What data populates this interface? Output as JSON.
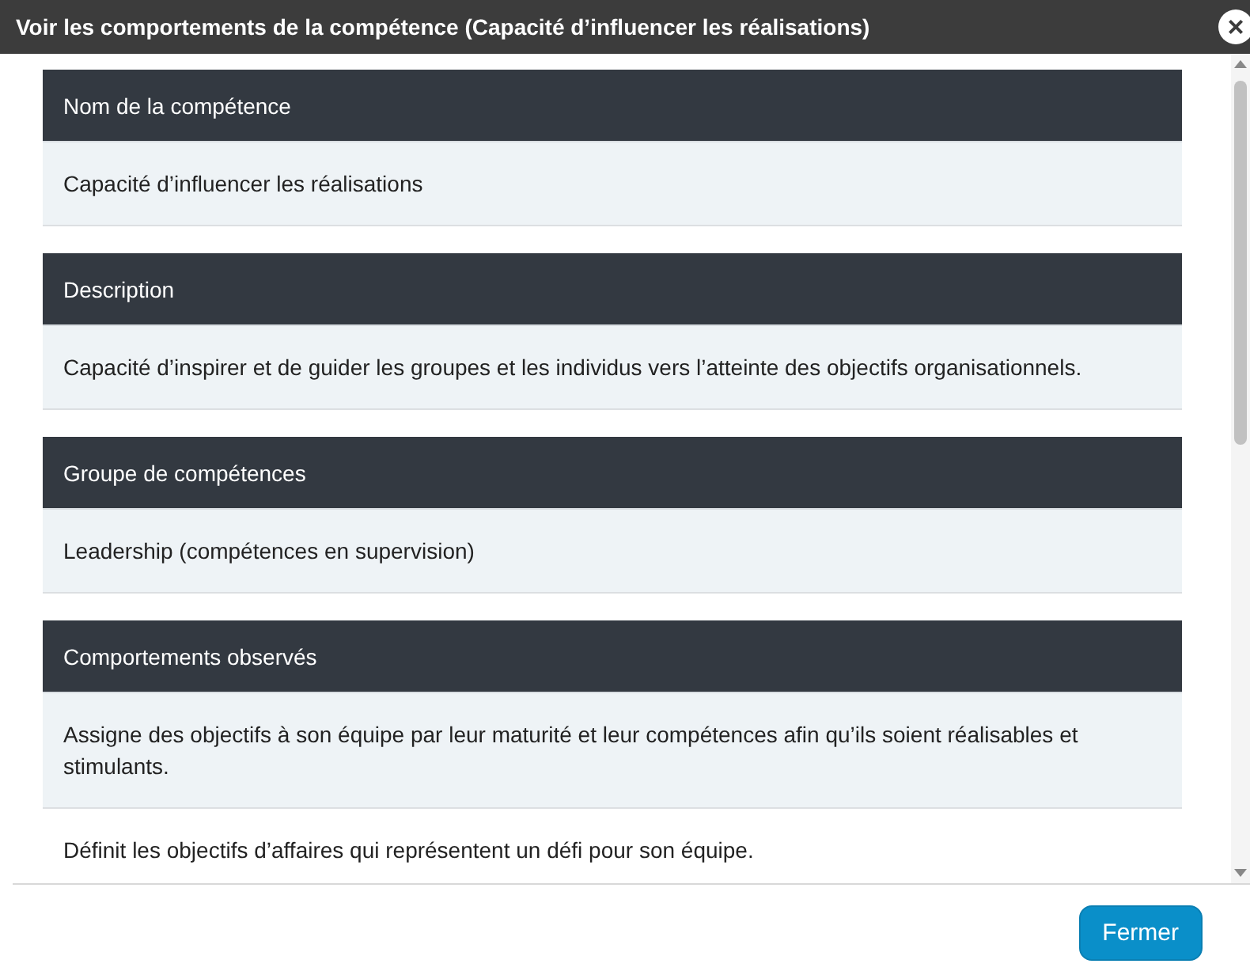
{
  "window": {
    "title": "Voir les comportements de la compétence (Capacité d’influencer les réalisations)",
    "close": "×"
  },
  "sections": [
    {
      "heading": "Nom de la compétence",
      "rows": [
        "Capacité d’influencer les réalisations"
      ]
    },
    {
      "heading": "Description",
      "rows": [
        "Capacité d’inspirer et de guider les groupes et les individus vers l’atteinte des objectifs organisationnels."
      ]
    },
    {
      "heading": "Groupe de compétences",
      "rows": [
        "Leadership (compétences en supervision)"
      ]
    },
    {
      "heading": "Comportements observés",
      "rows": [
        "Assigne des objectifs à son équipe par leur maturité et leur compétences afin qu’ils soient réalisables et stimulants.",
        "Définit les objectifs d’affaires qui représentent un défi pour son équipe."
      ]
    }
  ],
  "buttons": [
    "Fermer"
  ]
}
